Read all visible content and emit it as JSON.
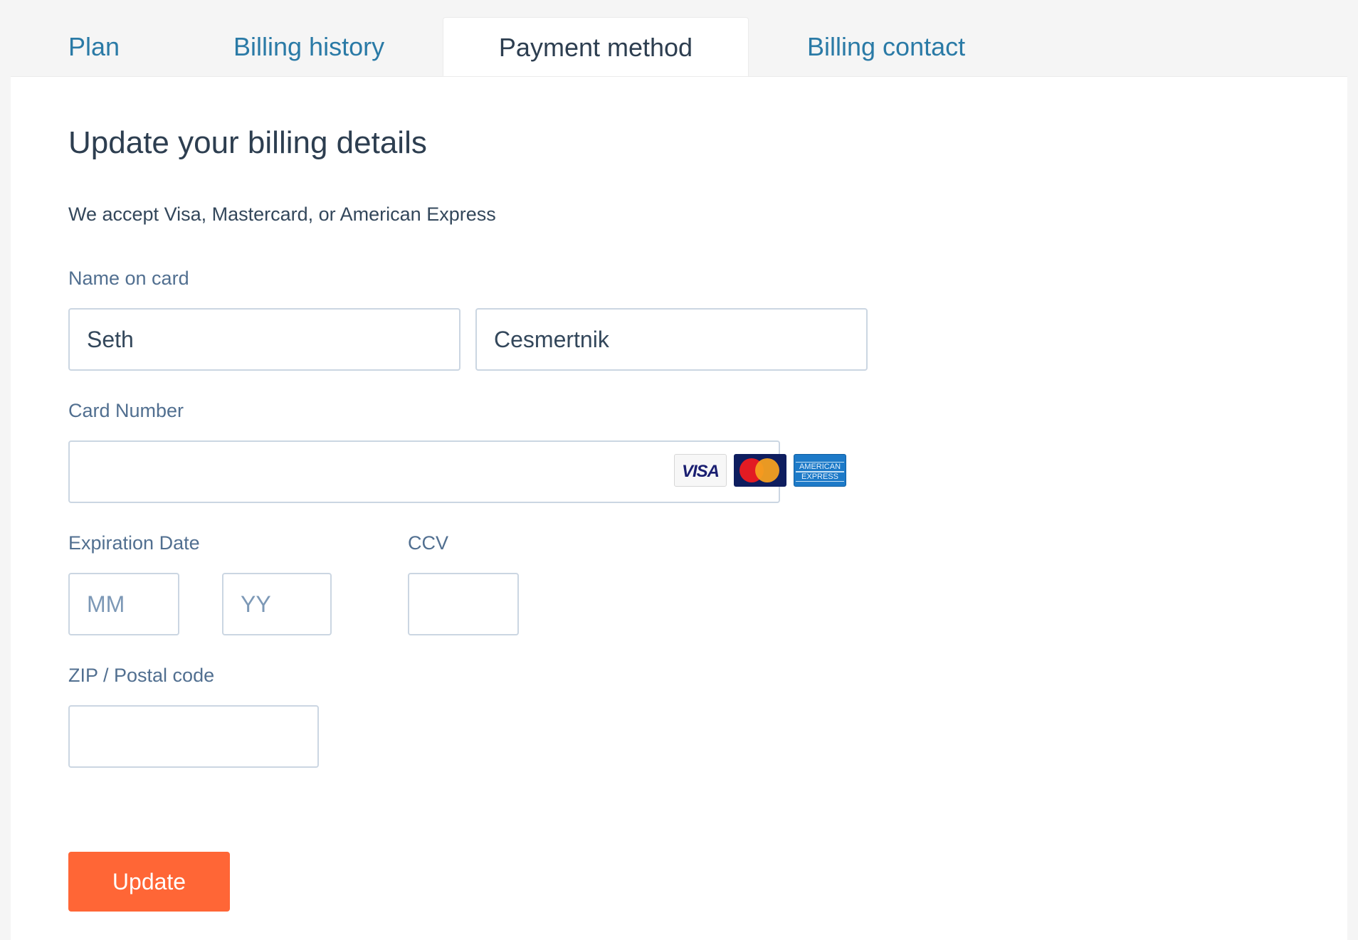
{
  "tabs": [
    {
      "label": "Plan",
      "active": false
    },
    {
      "label": "Billing history",
      "active": false
    },
    {
      "label": "Payment method",
      "active": true
    },
    {
      "label": "Billing contact",
      "active": false
    }
  ],
  "form": {
    "heading": "Update your billing details",
    "accepted_cards_text": "We accept Visa, Mastercard, or American Express",
    "name_label": "Name on card",
    "first_name_value": "Seth",
    "last_name_value": "Cesmertnik",
    "card_number_label": "Card Number",
    "card_number_value": "",
    "card_icons": [
      {
        "name": "visa",
        "text": "VISA"
      },
      {
        "name": "mastercard",
        "text": "MasterCard"
      },
      {
        "name": "american-express",
        "text": "AMERICAN EXPRESS"
      }
    ],
    "expiration_label": "Expiration Date",
    "month_placeholder": "MM",
    "year_placeholder": "YY",
    "ccv_label": "CCV",
    "zip_label": "ZIP / Postal code",
    "submit_label": "Update"
  },
  "colors": {
    "accent": "#ff6636",
    "link": "#2a7aa6",
    "text": "#2d3e50",
    "border": "#cbd6e2"
  }
}
